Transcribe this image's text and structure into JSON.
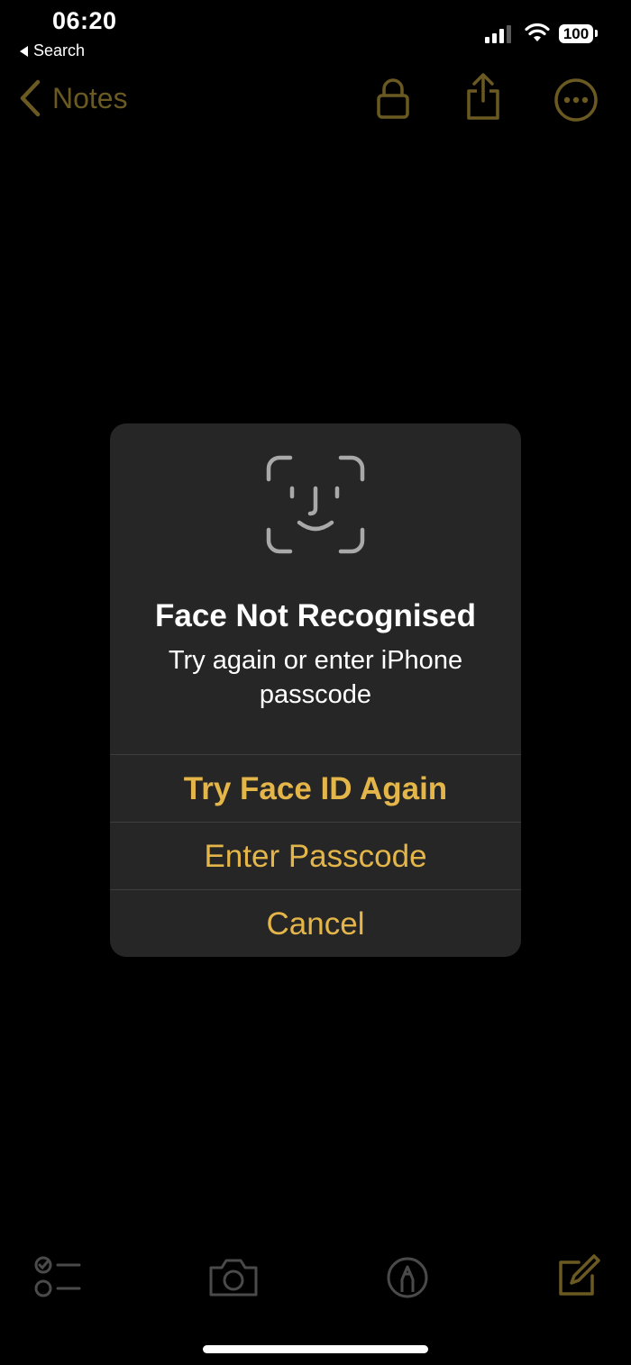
{
  "status_bar": {
    "time": "06:20",
    "back_app_label": "Search",
    "battery_level": "100"
  },
  "nav": {
    "back_label": "Notes",
    "icons": [
      "chevron-left-icon",
      "lock-icon",
      "share-icon",
      "more-icon"
    ]
  },
  "alert": {
    "icon": "face-id-icon",
    "title": "Face Not Recognised",
    "message": "Try again or enter iPhone passcode",
    "buttons": {
      "try_again": "Try Face ID Again",
      "enter_passcode": "Enter Passcode",
      "cancel": "Cancel"
    }
  },
  "toolbar": {
    "icons": [
      "checklist-icon",
      "camera-icon",
      "markup-icon",
      "compose-icon"
    ]
  },
  "colors": {
    "accent": "#e4b64a",
    "accent_dimmed": "#6a5a22",
    "alert_bg": "#262626",
    "background": "#000000"
  }
}
